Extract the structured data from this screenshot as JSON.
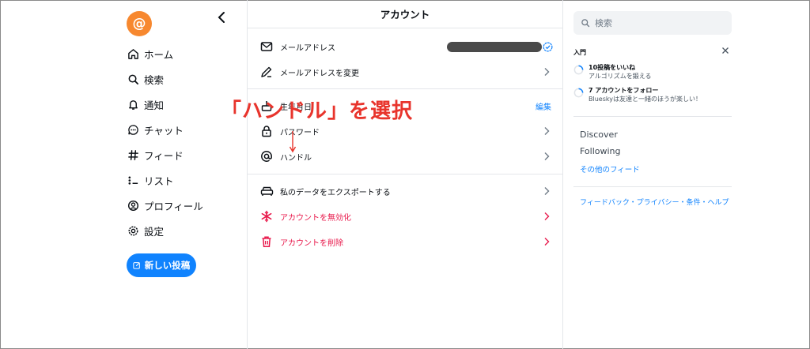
{
  "app": {
    "logo_glyph": "@",
    "accent": "#1083fe",
    "logo_color": "#f7882f",
    "danger": "#e8194b"
  },
  "nav": {
    "items": [
      {
        "label": "ホーム",
        "icon": "home-icon"
      },
      {
        "label": "検索",
        "icon": "search-icon"
      },
      {
        "label": "通知",
        "icon": "bell-icon"
      },
      {
        "label": "チャット",
        "icon": "chat-icon"
      },
      {
        "label": "フィード",
        "icon": "hash-icon"
      },
      {
        "label": "リスト",
        "icon": "list-icon"
      },
      {
        "label": "プロフィール",
        "icon": "profile-icon"
      },
      {
        "label": "設定",
        "icon": "gear-icon"
      }
    ],
    "post_label": "新しい投稿"
  },
  "main": {
    "title": "アカウント",
    "rows": {
      "email": "メールアドレス",
      "change_email": "メールアドレスを変更",
      "birthday": "生年月日",
      "birthday_edit": "編集",
      "password": "パスワード",
      "handle": "ハンドル",
      "export": "私のデータをエクスポートする",
      "deactivate": "アカウントを無効化",
      "delete": "アカウントを削除"
    },
    "overlay_text": "「ハンドル」を選択"
  },
  "right": {
    "search_placeholder": "検索",
    "intro_title": "入門",
    "tasks": [
      {
        "title": "10投稿をいいね",
        "subtitle": "アルゴリズムを鍛える"
      },
      {
        "title": "7 アカウントをフォロー",
        "subtitle": "Blueskyは友達と一緒のほうが楽しい！"
      }
    ],
    "feeds": [
      "Discover",
      "Following"
    ],
    "more_feeds": "その他のフィード",
    "footer": "フィードバック・プライバシー・条件・ヘルプ"
  }
}
